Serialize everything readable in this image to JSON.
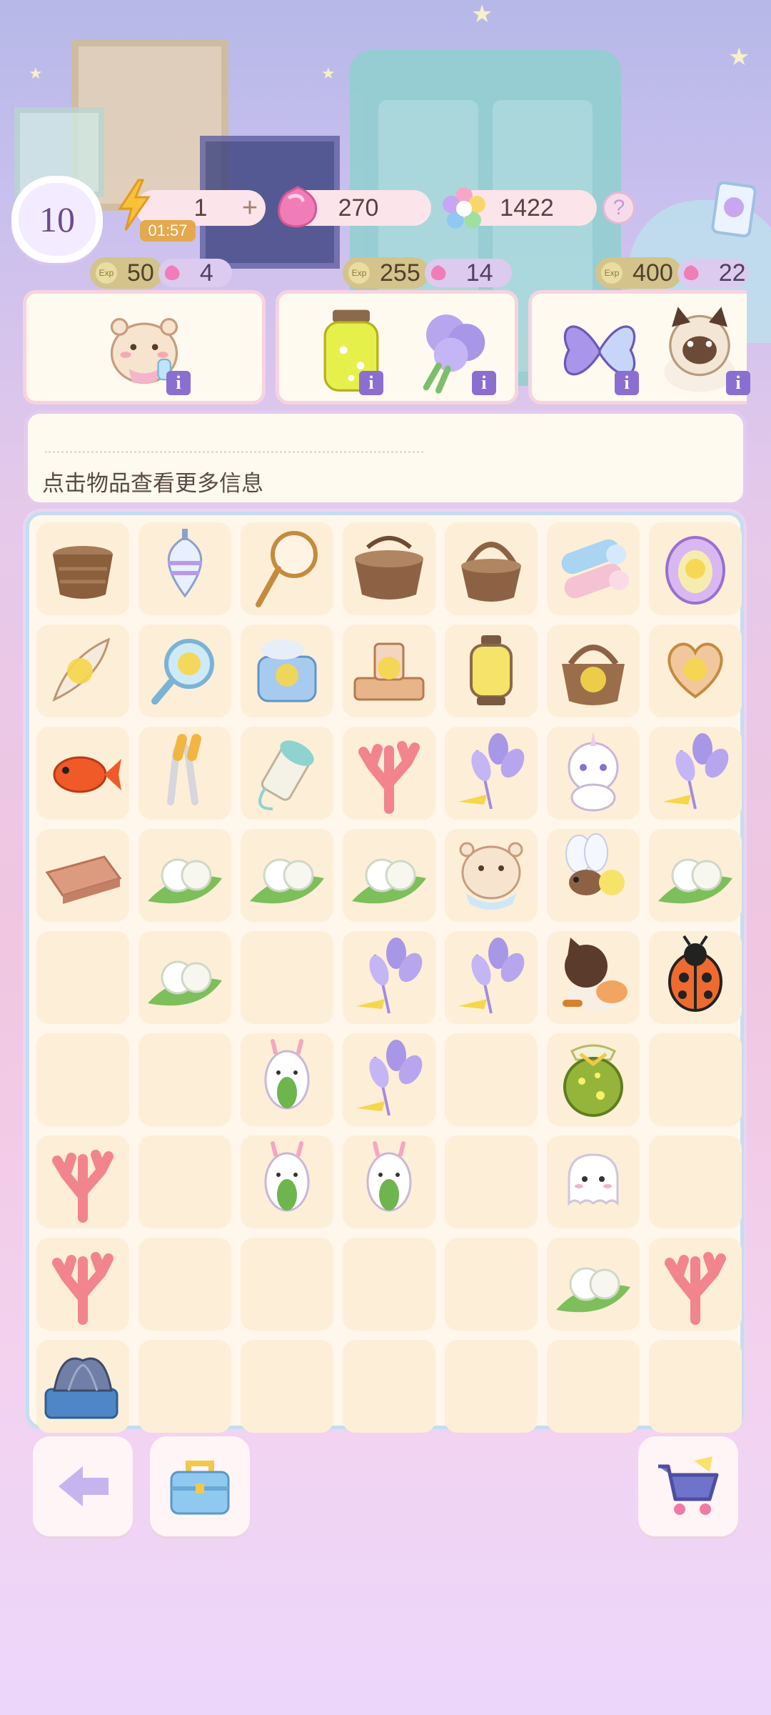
{
  "hud": {
    "level": "10",
    "energy": "1",
    "energy_plus": "+",
    "energy_timer": "01:57",
    "gems": "270",
    "rainbow": "1422",
    "help": "?"
  },
  "orders": [
    {
      "exp": "50",
      "gems": "4",
      "items": [
        "hamster-baby"
      ]
    },
    {
      "exp": "255",
      "gems": "14",
      "items": [
        "firefly-jar",
        "lavender-bouquet"
      ]
    },
    {
      "exp": "400",
      "gems": "22",
      "items": [
        "butterfly",
        "siamese-cat"
      ]
    }
  ],
  "info_hint": "点击物品查看更多信息",
  "exp_label": "Exp",
  "info_icon": "i",
  "board": [
    [
      "basket-flat",
      "spinning-top",
      "butterfly-net",
      "basket-wicker",
      "basket-handle",
      "towel-roll",
      "egg-locked"
    ],
    [
      "feather-locked",
      "magnifier-locked",
      "toaster-locked",
      "scale-locked",
      "lantern-locked",
      "basket-locked",
      "heart-sign-locked"
    ],
    [
      "goldfish",
      "tongs",
      "thread-spool",
      "coral",
      "lavender",
      "unicorn-cat",
      "lavender"
    ],
    [
      "wood-plank",
      "pearls-leaf",
      "pearls-leaf",
      "pearls-leaf",
      "hamster-baby",
      "firefly",
      "pearls-leaf"
    ],
    [
      "",
      "pearls-leaf",
      "",
      "lavender",
      "lavender",
      "calico-cat",
      "ladybug"
    ],
    [
      "",
      "",
      "bunny-leaf",
      "lavender",
      "",
      "firefly-jar",
      ""
    ],
    [
      "coral",
      "",
      "bunny-leaf",
      "bunny-leaf",
      "",
      "ghost",
      ""
    ],
    [
      "coral",
      "",
      "",
      "",
      "",
      "pearls-leaf",
      "coral"
    ],
    [
      "mussel-box",
      "",
      "",
      "",
      "",
      "",
      ""
    ]
  ],
  "buttons": [
    "back-icon",
    "toolbox-icon",
    "shop-cart-icon"
  ],
  "colors": {
    "accent": "#8b6fd0",
    "board_border": "#c7dcf0",
    "cell": "#fdeed7"
  }
}
